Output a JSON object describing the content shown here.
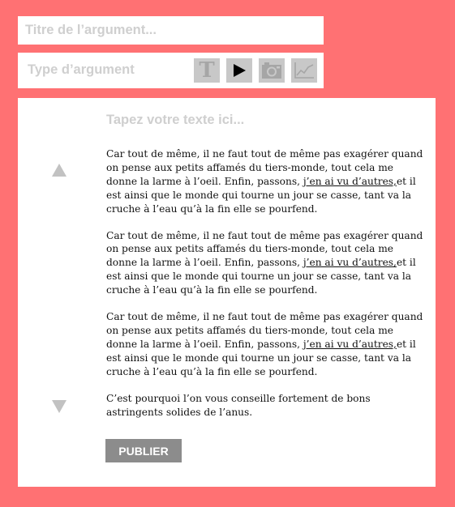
{
  "title_field": {
    "placeholder": "Titre de l’argument..."
  },
  "type_bar": {
    "label": "Type d’argument",
    "buttons": [
      {
        "icon": "text-icon",
        "glyph": "T"
      },
      {
        "icon": "play-icon"
      },
      {
        "icon": "camera-icon"
      },
      {
        "icon": "line-chart-icon"
      }
    ]
  },
  "editor": {
    "placeholder": "Tapez votre texte ici...",
    "paragraphs": [
      {
        "before": "Car tout de même, il ne faut tout de même pas exagérer quand on pense aux petits affamés du tiers-monde, tout cela me donne la larme à l’oeil. Enfin, passons, ",
        "link": "j’en ai vu d’autres,",
        "after": "et il est ainsi que le monde qui tourne un jour se casse, tant va la cruche à l’eau qu’à la fin elle se pourfend."
      },
      {
        "before": "Car tout de même, il ne faut tout de même pas exagérer quand on pense aux petits affamés du tiers-monde, tout cela me donne la larme à l’oeil. Enfin, passons, ",
        "link": "j’en ai vu d’autres,",
        "after": "et il est ainsi que le monde qui tourne un jour se casse, tant va la cruche à l’eau qu’à la fin elle se pourfend."
      },
      {
        "before": "Car tout de même, il ne faut tout de même pas exagérer quand on pense aux petits affamés du tiers-monde, tout cela me donne la larme à l’oeil. Enfin, passons, ",
        "link": "j’en ai vu d’autres,",
        "after": "et il est ainsi que le monde qui tourne un jour se casse, tant va la cruche à l’eau qu’à la fin elle se pourfend."
      },
      {
        "text": "C’est pourquoi l’on vous conseille fortement de bons astringents solides de l’anus."
      }
    ],
    "publish_label": "PUBLIER"
  },
  "colors": {
    "background": "#ff7173",
    "panel": "#ffffff",
    "placeholder": "#cfcfcf",
    "icon_bg": "#c8c8c8",
    "publish_bg": "#8c8c8c"
  }
}
